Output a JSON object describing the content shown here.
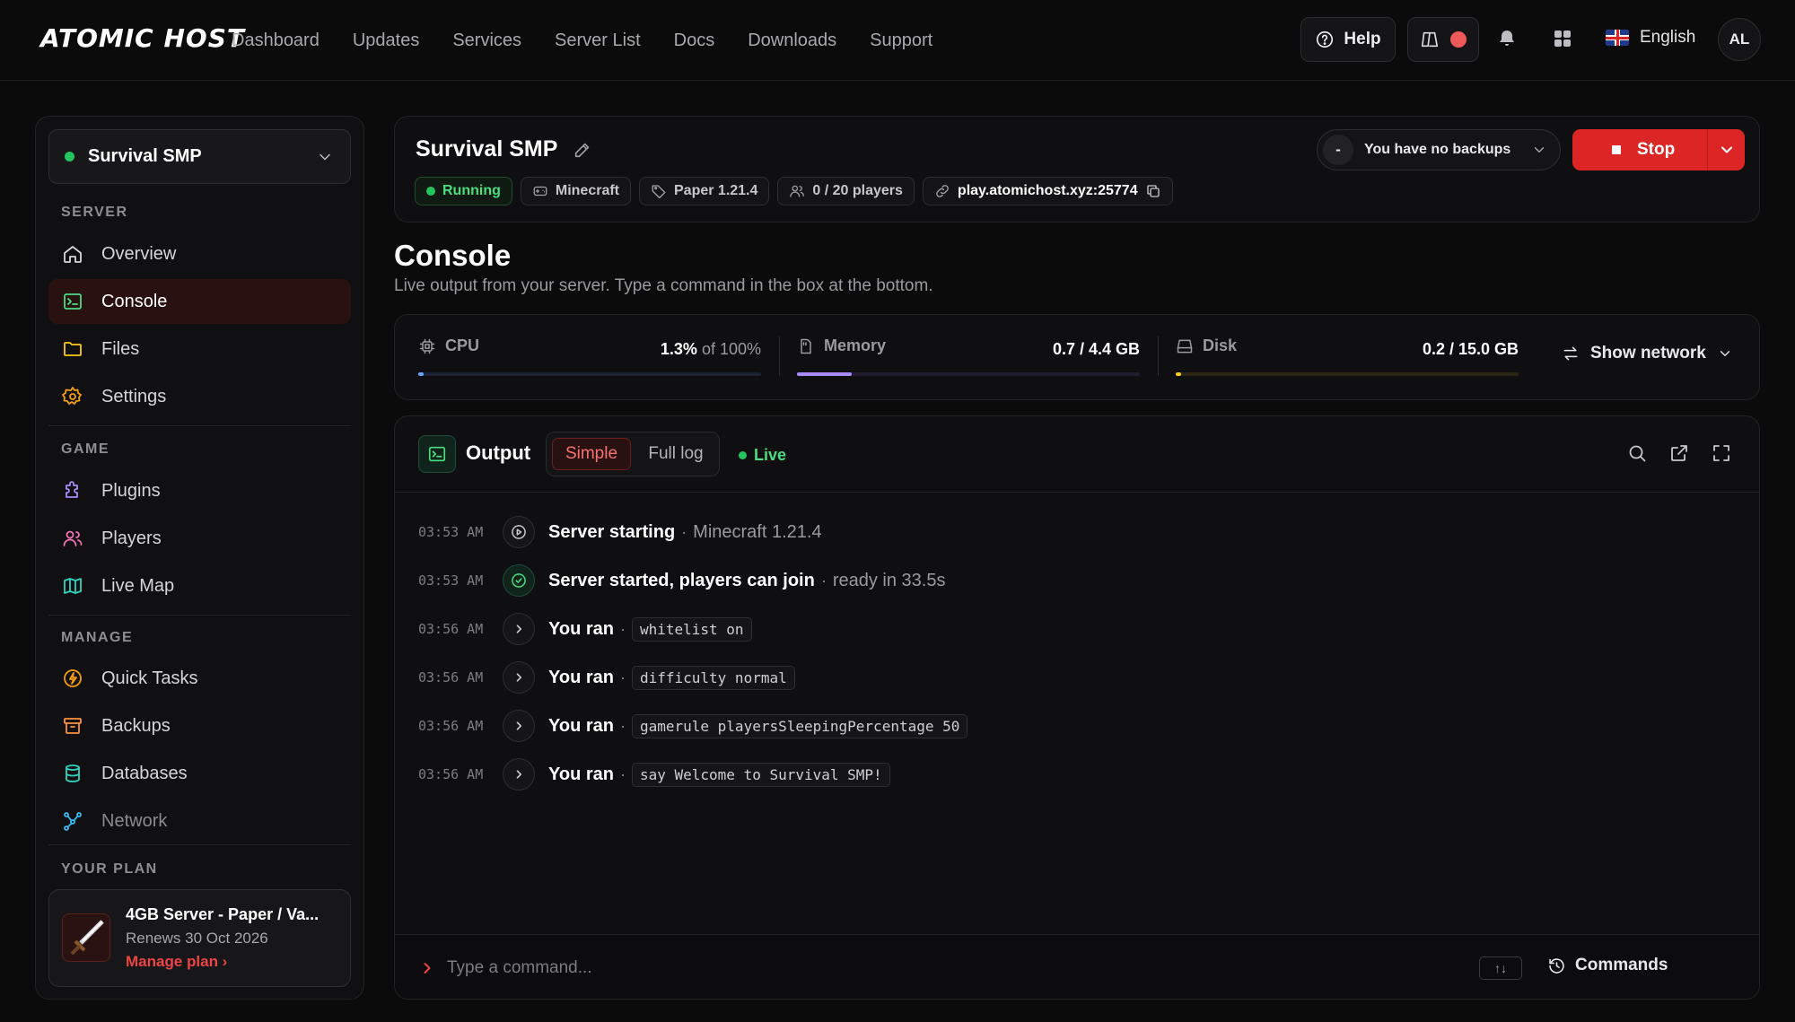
{
  "brand": {
    "logo": "ATOMIC HOST"
  },
  "nav": [
    "Dashboard",
    "Updates",
    "Services",
    "Server List",
    "Docs",
    "Downloads",
    "Support"
  ],
  "topbar": {
    "help_label": "Help",
    "language": "English",
    "avatar_initials": "AL"
  },
  "sidebar": {
    "server_name": "Survival SMP",
    "sections": {
      "server": "SERVER",
      "game": "GAME",
      "manage": "MANAGE",
      "plan": "YOUR PLAN"
    },
    "server_items": [
      {
        "label": "Overview",
        "icon": "home-icon"
      },
      {
        "label": "Console",
        "icon": "terminal-icon",
        "active": true
      },
      {
        "label": "Files",
        "icon": "folder-icon"
      },
      {
        "label": "Settings",
        "icon": "gear-icon"
      }
    ],
    "game_items": [
      {
        "label": "Plugins",
        "icon": "puzzle-icon"
      },
      {
        "label": "Players",
        "icon": "users-icon"
      },
      {
        "label": "Live Map",
        "icon": "map-icon"
      }
    ],
    "manage_items": [
      {
        "label": "Quick Tasks",
        "icon": "bolt-icon"
      },
      {
        "label": "Backups",
        "icon": "archive-icon"
      },
      {
        "label": "Databases",
        "icon": "database-icon"
      },
      {
        "label": "Network",
        "icon": "network-icon"
      }
    ],
    "plan": {
      "title": "4GB Server - Paper / Va...",
      "renews": "Renews 30 Oct 2026",
      "manage": "Manage plan ›"
    }
  },
  "header": {
    "server_title": "Survival SMP",
    "chips": {
      "status": "Running",
      "game": "Minecraft",
      "version": "Paper 1.21.4",
      "players": "0 / 20 players",
      "address": "play.atomichost.xyz:25774"
    },
    "backup_badge": "-",
    "backup_label": "You have no backups",
    "stop_label": "Stop"
  },
  "page": {
    "title": "Console",
    "subtitle": "Live output from your server. Type a command in the box at the bottom."
  },
  "stats": {
    "cpu": {
      "label": "CPU",
      "value": "1.3%",
      "suffix": " of 100%",
      "fraction": 0.013,
      "color": "#60a5fa"
    },
    "memory": {
      "label": "Memory",
      "value": "0.7 / 4.4 GB",
      "fraction": 0.16,
      "color": "#a78bfa"
    },
    "disk": {
      "label": "Disk",
      "value": "0.2 / 15.0 GB",
      "fraction": 0.013,
      "color": "#facc15"
    },
    "show_network": "Show network"
  },
  "output": {
    "title": "Output",
    "modes": [
      "Simple",
      "Full log"
    ],
    "live": "Live",
    "logs": [
      {
        "time": "03:53 AM",
        "icon": "play-icon",
        "main": "Server starting",
        "detail": "Minecraft 1.21.4"
      },
      {
        "time": "03:53 AM",
        "icon": "check-icon",
        "main": "Server started, players can join",
        "detail": "ready in 33.5s"
      },
      {
        "time": "03:56 AM",
        "icon": "chevron-right-icon",
        "main": "You ran",
        "code": "whitelist on"
      },
      {
        "time": "03:56 AM",
        "icon": "chevron-right-icon",
        "main": "You ran",
        "code": "difficulty normal"
      },
      {
        "time": "03:56 AM",
        "icon": "chevron-right-icon",
        "main": "You ran",
        "code": "gamerule playersSleepingPercentage 50"
      },
      {
        "time": "03:56 AM",
        "icon": "chevron-right-icon",
        "main": "You ran",
        "code": "say Welcome to Survival SMP!"
      }
    ],
    "separator": "·",
    "command_placeholder": "Type a command...",
    "history_hint": "↑↓",
    "commands_label": "Commands"
  }
}
